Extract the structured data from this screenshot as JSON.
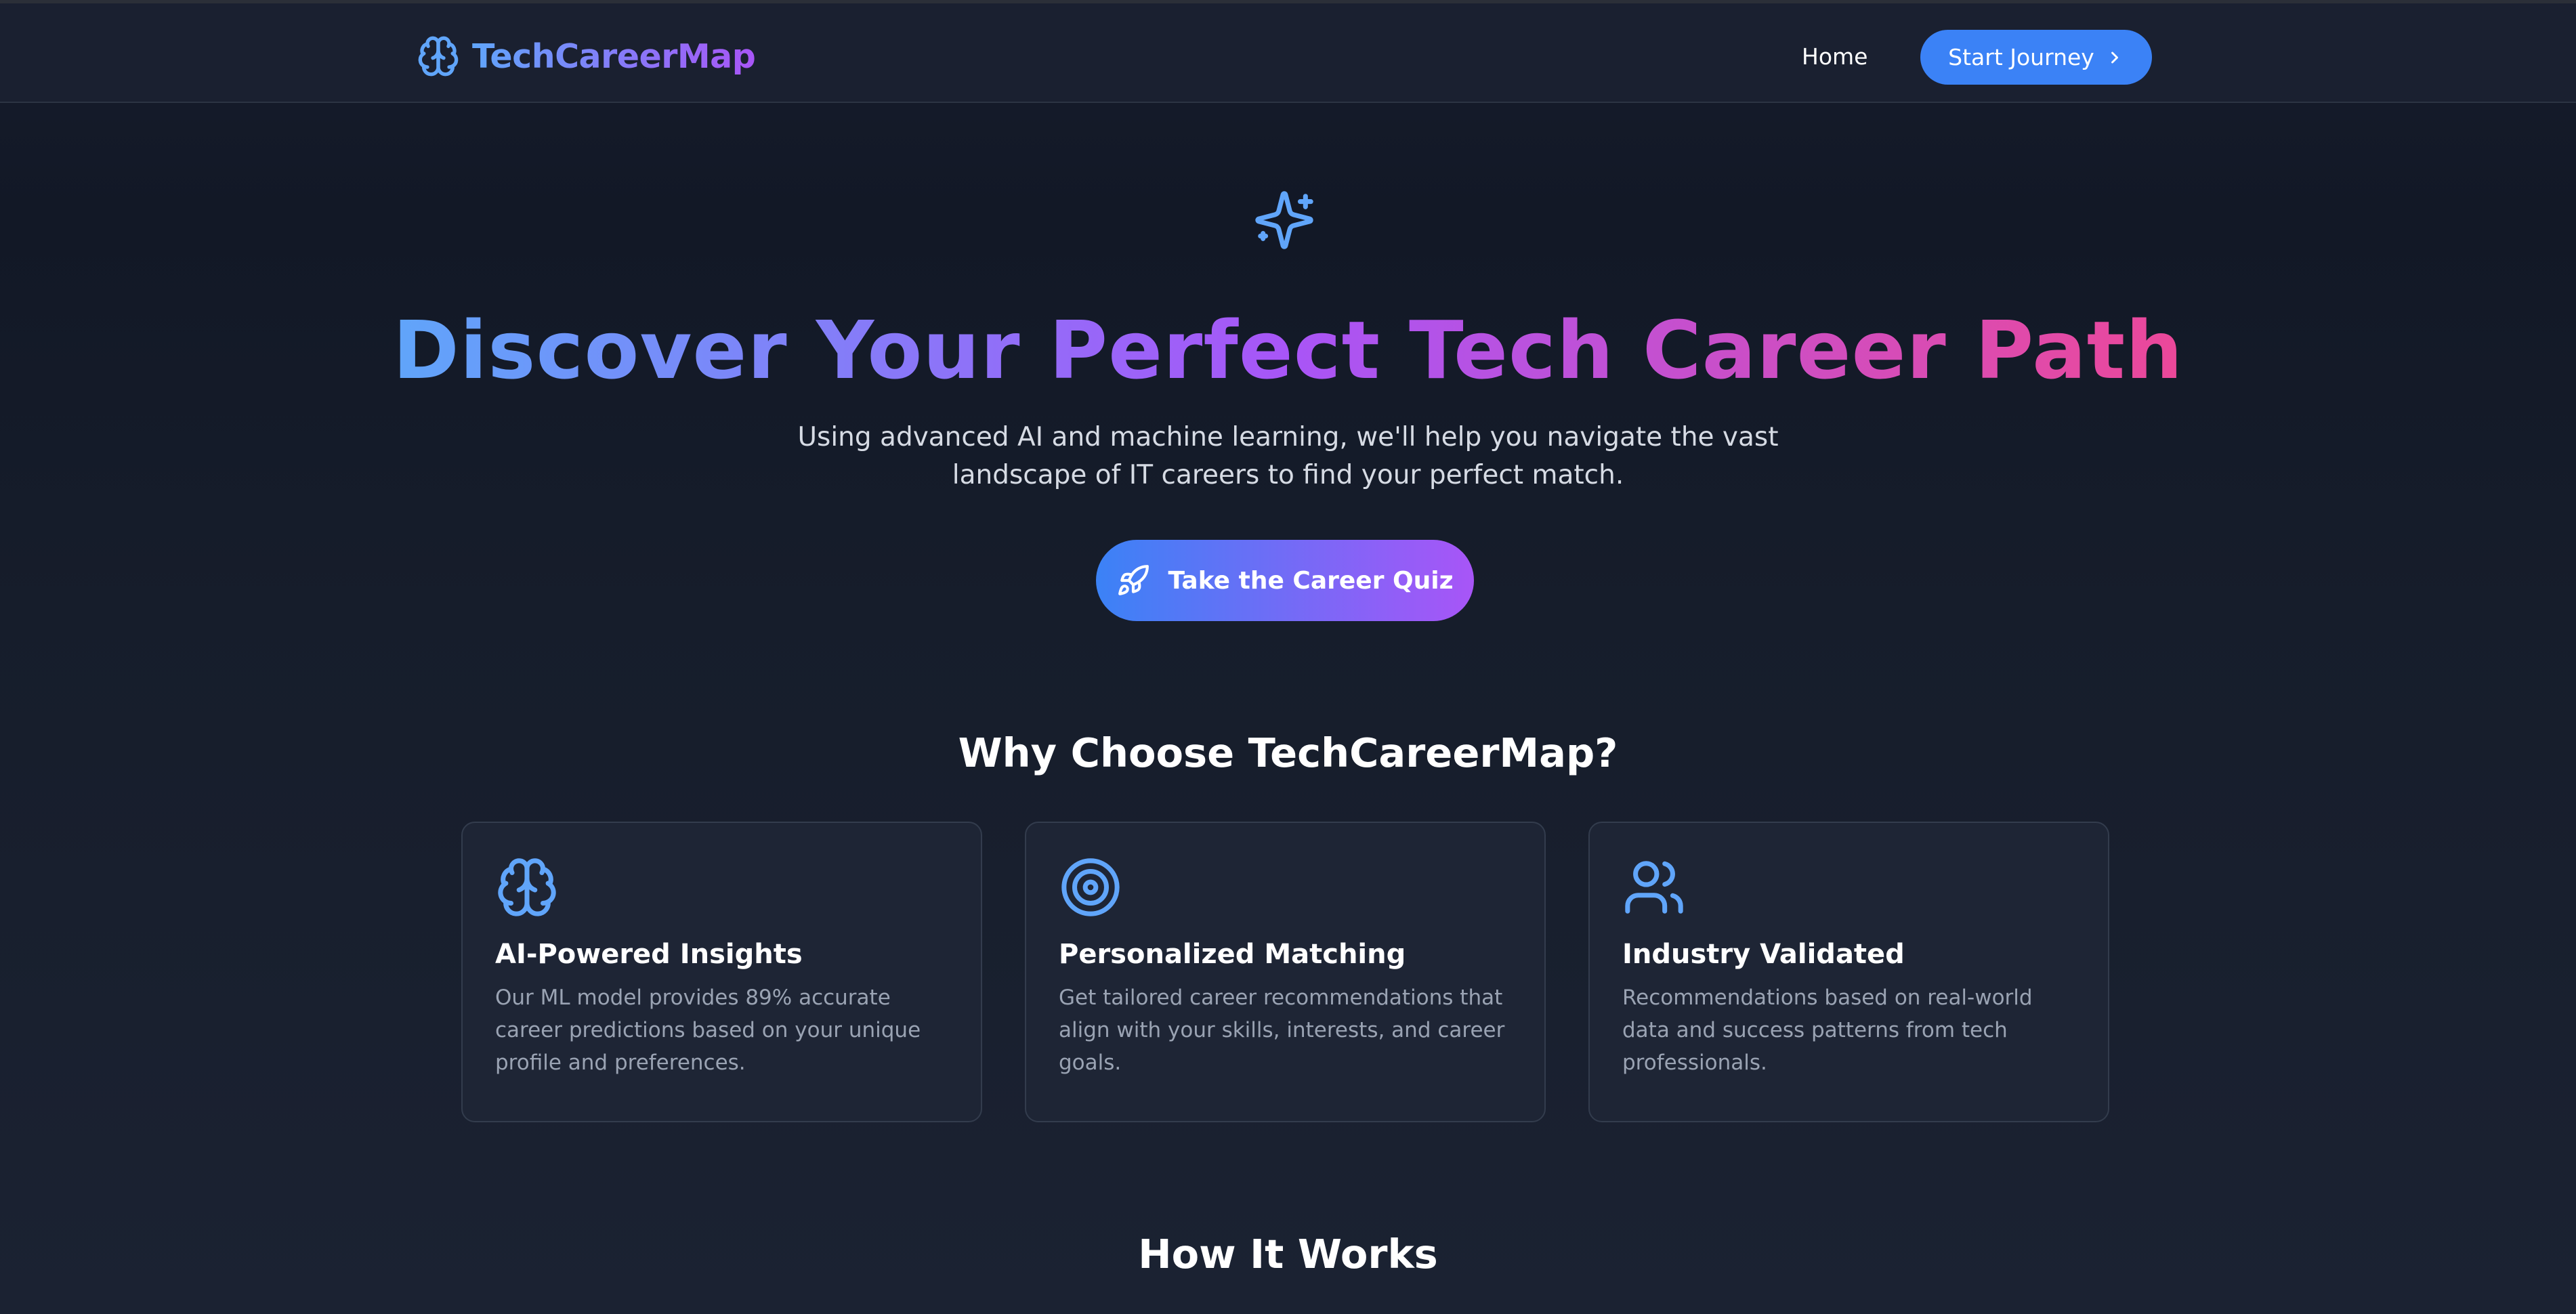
{
  "header": {
    "brand": "TechCareerMap",
    "brand_icon": "brain-icon",
    "nav_home": "Home",
    "start_button": "Start Journey",
    "start_button_icon": "chevron-right-icon"
  },
  "hero": {
    "icon": "sparkles-icon",
    "title": "Discover Your Perfect Tech Career Path",
    "subtitle": "Using advanced AI and machine learning, we'll help you navigate the vast landscape of IT careers to find your perfect match.",
    "cta": "Take the Career Quiz",
    "cta_icon": "rocket-icon"
  },
  "why": {
    "title": "Why Choose TechCareerMap?",
    "cards": [
      {
        "icon": "brain-icon",
        "title": "AI-Powered Insights",
        "description": "Our ML model provides 89% accurate career predictions based on your unique profile and preferences."
      },
      {
        "icon": "target-icon",
        "title": "Personalized Matching",
        "description": "Get tailored career recommendations that align with your skills, interests, and career goals."
      },
      {
        "icon": "users-icon",
        "title": "Industry Validated",
        "description": "Recommendations based on real-world data and success patterns from tech professionals."
      }
    ]
  },
  "how": {
    "title": "How It Works"
  },
  "colors": {
    "accent_blue": "#3b82f6",
    "accent_purple": "#a855f7",
    "accent_pink": "#ec4899",
    "background": "#151b29"
  }
}
